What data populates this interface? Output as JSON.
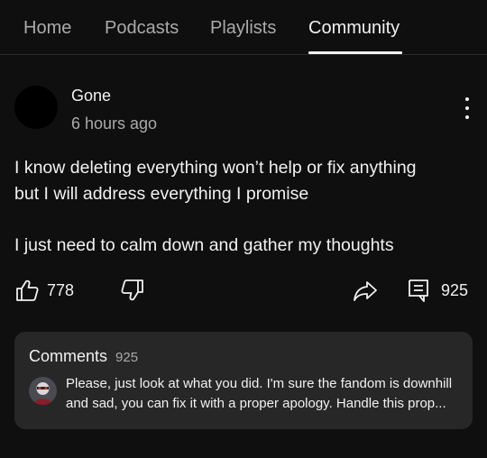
{
  "tabs": [
    {
      "label": "Home",
      "active": false
    },
    {
      "label": "Podcasts",
      "active": false
    },
    {
      "label": "Playlists",
      "active": false
    },
    {
      "label": "Community",
      "active": true
    }
  ],
  "post": {
    "author": "Gone",
    "time": "6 hours ago",
    "body": [
      "I know deleting everything won’t help or fix anything",
      "but I will address everything I promise",
      "",
      "I just need to calm down and gather my thoughts"
    ],
    "likes": "778",
    "comments_count": "925",
    "icons": {
      "like": "thumbs-up-icon",
      "dislike": "thumbs-down-icon",
      "share": "share-icon",
      "comment": "comment-icon",
      "more": "more-vertical-icon"
    }
  },
  "comments_panel": {
    "title": "Comments",
    "count": "925",
    "top_comment_lines": [
      "Please, just look at what you did. I'm sure the fandom is downhill",
      "and sad, you can fix it with a proper apology. Handle this prop..."
    ]
  },
  "colors": {
    "background": "#0f0f0f",
    "card": "#272727",
    "text": "#f1f1f1",
    "secondary_text": "#aaaaaa"
  }
}
